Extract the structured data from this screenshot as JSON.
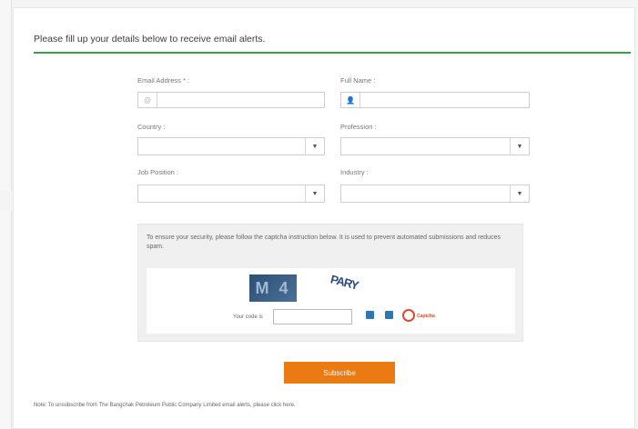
{
  "form": {
    "title": "Please fill up your details below to receive email alerts.",
    "email_label": "Email Address * :",
    "email_icon": "@",
    "email_value": "",
    "fullname_label": "Full Name :",
    "fullname_icon": "👤",
    "fullname_value": "",
    "country_label": "Country :",
    "country_value": "",
    "profession_label": "Profession :",
    "profession_value": "",
    "jobposition_label": "Job Position :",
    "jobposition_value": "",
    "industry_label": "Industry :",
    "industry_value": "",
    "dropdown_glyph": "▼"
  },
  "captcha": {
    "instructions": "To ensure your security, please follow the captcha instruction below. It is used to prevent automated submissions and reduces spam.",
    "image1_text": "M 4",
    "image2_text": "PARY",
    "code_label": "Your code is",
    "code_value": "",
    "logo_text": "Captcha"
  },
  "subscribe_label": "Subscribe",
  "note": "Note: To unsubscribe from The Bangchak Petroleum Public Company Limited email alerts, please click here.",
  "colors": {
    "accent_green": "#3aa14a",
    "button_orange": "#ec7a12"
  }
}
